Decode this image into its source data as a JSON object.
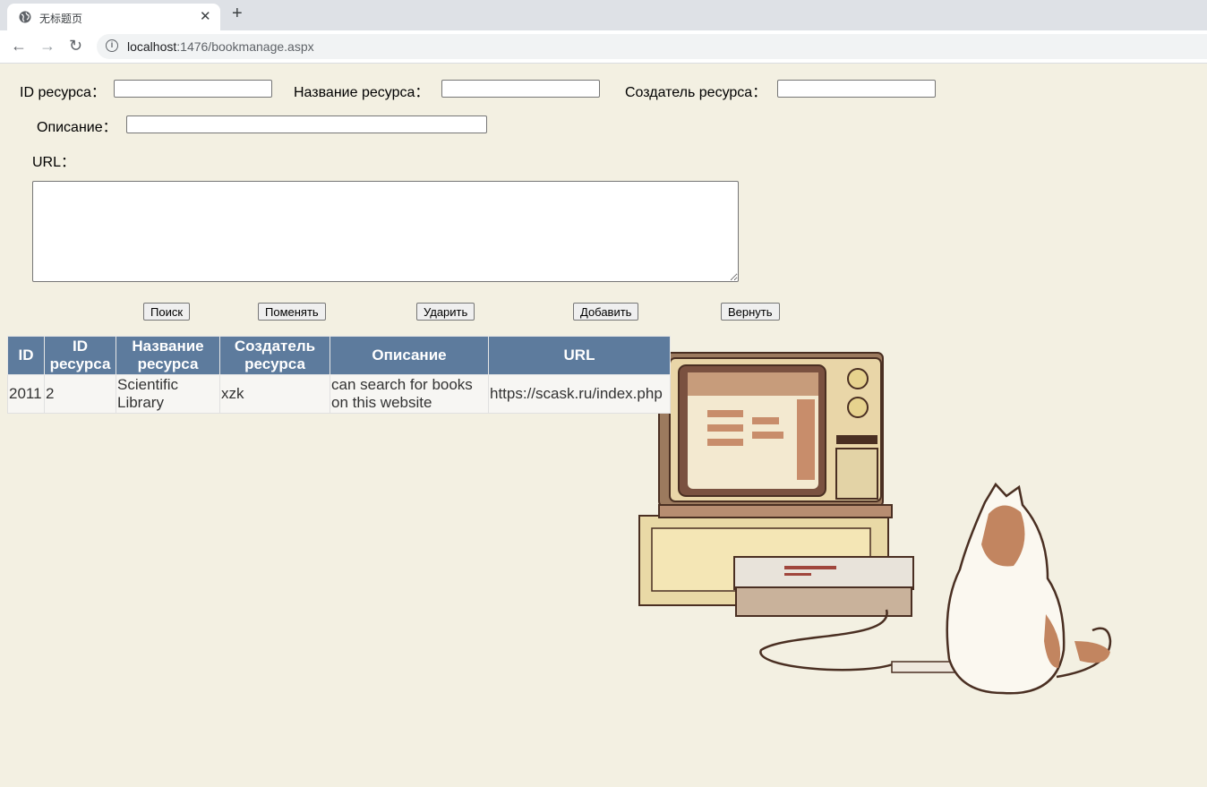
{
  "browser": {
    "tab_title": "无标题页",
    "url_host": "localhost",
    "url_path": ":1476/bookmanage.aspx"
  },
  "form": {
    "id_label": "ID ресурса：",
    "name_label": "Название ресурса：",
    "creator_label": "Создатель ресурса：",
    "desc_label": "Описание：",
    "url_label": "URL：",
    "id_value": "",
    "name_value": "",
    "creator_value": "",
    "desc_value": "",
    "url_value": ""
  },
  "buttons": {
    "search": "Поиск",
    "change": "Поменять",
    "delete": "Ударить",
    "add": "Добавить",
    "back": "Вернуть"
  },
  "table": {
    "headers": {
      "id": "ID",
      "res_id": "ID ресурса",
      "name": "Название ресурса",
      "creator": "Создатель ресурса",
      "desc": "Описание",
      "url": "URL"
    },
    "rows": [
      {
        "id": "2011",
        "res_id": "2",
        "name": "Scientific Library",
        "creator": "xzk",
        "desc": "can search for books on this website",
        "url": "https://scask.ru/index.php"
      }
    ]
  },
  "colors": {
    "page_bg": "#f3f0e2",
    "header_bg": "#5d7b9d"
  }
}
